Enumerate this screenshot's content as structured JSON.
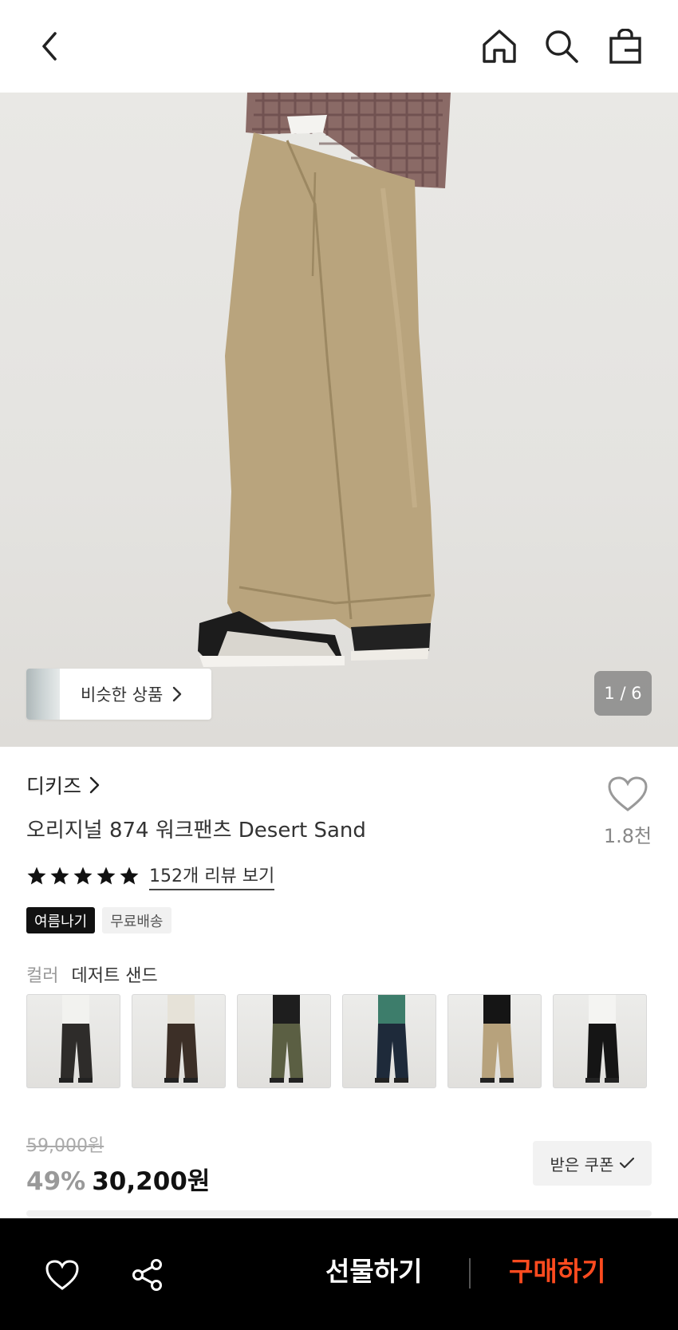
{
  "header": {
    "icons": [
      "chevron-left-icon",
      "home-icon",
      "search-icon",
      "shopping-bag-icon"
    ]
  },
  "hero": {
    "similar_label": "비슷한 상품",
    "counter": "1 / 6"
  },
  "product": {
    "brand": "디키즈",
    "title": "오리지널 874 워크팬츠 Desert Sand",
    "like_count": "1.8천",
    "rating_stars": 5,
    "reviews_link": "152개 리뷰 보기",
    "tags": [
      "여름나기",
      "무료배송"
    ],
    "color_label": "컬러",
    "color_value": "데저트 샌드",
    "swatches": [
      {
        "pants": "#2e2c2a",
        "top": "#f2f2ef"
      },
      {
        "pants": "#3c2f27",
        "top": "#e6e2d8"
      },
      {
        "pants": "#5b5f43",
        "top": "#1e1e1e"
      },
      {
        "pants": "#1e2a3a",
        "top": "#3d7d6b"
      },
      {
        "pants": "#b7a27c",
        "top": "#151515"
      },
      {
        "pants": "#151515",
        "top": "#f4f4f2"
      }
    ]
  },
  "pricing": {
    "original": "59,000원",
    "discount": "49%",
    "price": "30,200원",
    "coupon_label": "받은 쿠폰"
  },
  "bottom": {
    "gift_label": "선물하기",
    "buy_label": "구매하기",
    "buy_color": "#ff4b1f"
  }
}
